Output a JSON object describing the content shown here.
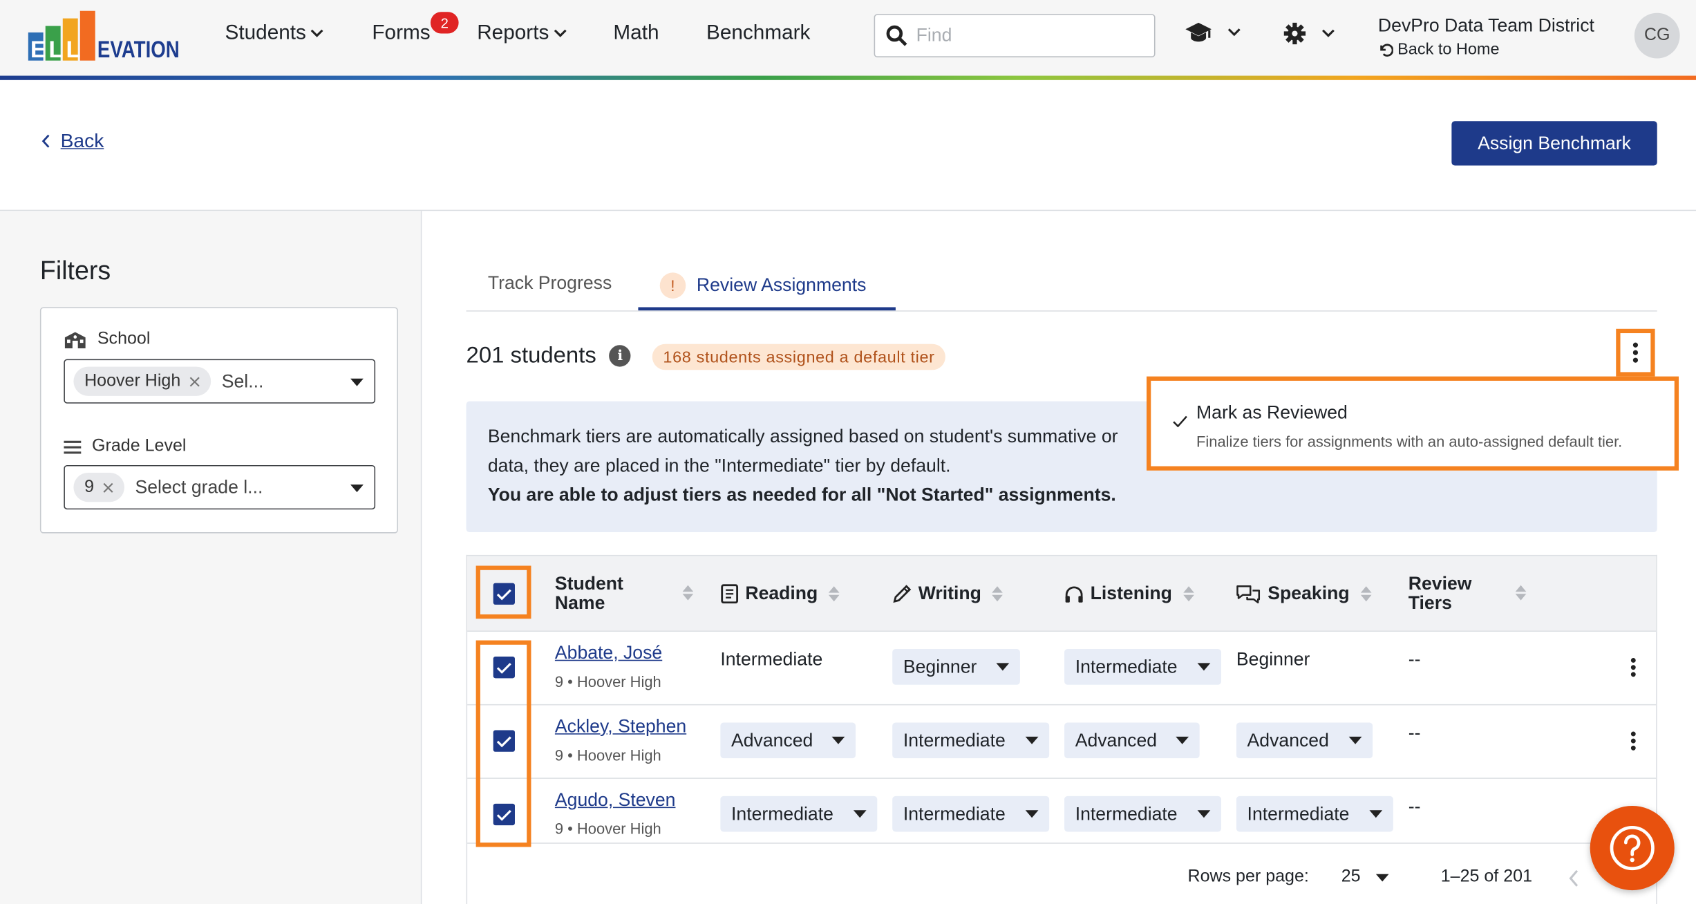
{
  "header": {
    "logo_text": "ELLEVATION",
    "nav": [
      {
        "label": "Students"
      },
      {
        "label": "Forms",
        "badge": "2"
      },
      {
        "label": "Reports"
      },
      {
        "label": "Math"
      },
      {
        "label": "Benchmark"
      }
    ],
    "search_placeholder": "Find",
    "district": "DevPro Data Team District",
    "back_to_home": "Back to Home",
    "avatar_initials": "CG"
  },
  "page": {
    "back_label": "Back",
    "assign_button": "Assign Benchmark"
  },
  "filters": {
    "title": "Filters",
    "school_label": "School",
    "school_chip": "Hoover High",
    "school_placeholder": "Sel...",
    "grade_label": "Grade Level",
    "grade_chip": "9",
    "grade_placeholder": "Select grade l..."
  },
  "tabs": [
    {
      "label": "Track Progress"
    },
    {
      "label": "Review Assignments",
      "warning": "!"
    }
  ],
  "summary": {
    "count": "201 students",
    "info": "i",
    "default_tier_pill": "168 students assigned a default tier"
  },
  "menu": {
    "title": "Mark as Reviewed",
    "desc": "Finalize tiers for assignments with an auto-assigned default tier."
  },
  "infobox": {
    "line1": "Benchmark tiers are automatically assigned based on student's summative or",
    "line2": "data, they are placed in the \"Intermediate\" tier by default.",
    "line3": "You are able to adjust tiers as needed for all \"Not Started\" assignments."
  },
  "table": {
    "headers": {
      "name_1": "Student",
      "name_2": "Name",
      "reading": "Reading",
      "writing": "Writing",
      "listening": "Listening",
      "speaking": "Speaking",
      "review_1": "Review",
      "review_2": "Tiers"
    },
    "rows": [
      {
        "name": "Abbate, José",
        "sub": "9 • Hoover High",
        "reading": "Intermediate",
        "writing": "Beginner",
        "listening": "Intermediate",
        "speaking": "Beginner",
        "review": "--"
      },
      {
        "name": "Ackley, Stephen",
        "sub": "9 • Hoover High",
        "reading": "Advanced",
        "writing": "Intermediate",
        "listening": "Advanced",
        "speaking": "Advanced",
        "review": "--"
      },
      {
        "name": "Agudo, Steven",
        "sub": "9 • Hoover High",
        "reading": "Intermediate",
        "writing": "Intermediate",
        "listening": "Intermediate",
        "speaking": "Intermediate",
        "review": "--"
      }
    ]
  },
  "pagination": {
    "rows_label": "Rows per page:",
    "rows_value": "25",
    "range": "1–25 of 201"
  },
  "colors": {
    "primary": "#1e3a8a",
    "highlight": "#f58220",
    "help": "#e8510e"
  }
}
